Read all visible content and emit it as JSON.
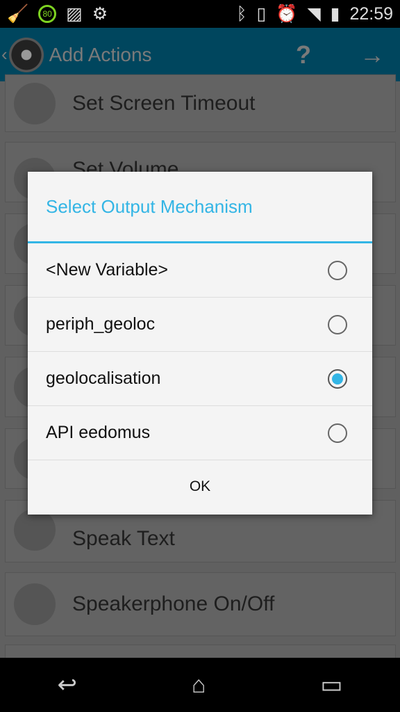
{
  "status_bar": {
    "time": "22:59",
    "battery_widget": "80",
    "icons": [
      "cleaner-icon",
      "battery-ring-icon",
      "image-icon",
      "gear-icon",
      "bluetooth-icon",
      "rotate-icon",
      "alarm-icon",
      "wifi-icon",
      "signal-icon",
      "battery-charging-icon"
    ]
  },
  "app_bar": {
    "title": "Add Actions",
    "help": "?",
    "next": "→",
    "back": "‹"
  },
  "actions": [
    "Set Screen Timeout",
    "Set Volume",
    "",
    "",
    "",
    "",
    "Speak Text",
    "Speakerphone On/Off",
    ""
  ],
  "dialog": {
    "title": "Select Output Mechanism",
    "options": [
      {
        "label": "<New Variable>",
        "selected": false
      },
      {
        "label": "periph_geoloc",
        "selected": false
      },
      {
        "label": "geolocalisation",
        "selected": true
      },
      {
        "label": "API eedomus",
        "selected": false
      }
    ],
    "ok": "OK",
    "accent": "#33b5e5"
  },
  "nav": {
    "back": "↩",
    "home": "⌂",
    "recents": "▭"
  }
}
